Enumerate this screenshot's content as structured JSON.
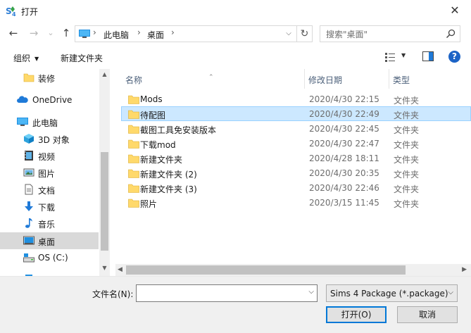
{
  "window": {
    "title": "打开",
    "close_glyph": "✕"
  },
  "nav": {
    "back_glyph": "←",
    "forward_glyph": "→",
    "recent_glyph": "⌄",
    "up_glyph": "↑",
    "breadcrumbs": [
      "此电脑",
      "桌面"
    ],
    "refresh_glyph": "↻",
    "search_placeholder": "搜索\"桌面\""
  },
  "toolbar": {
    "organize_label": "组织",
    "new_folder_label": "新建文件夹"
  },
  "sidebar": {
    "items": [
      {
        "label": "装修",
        "icon": "folder-icon"
      },
      {
        "label": "OneDrive",
        "icon": "cloud-icon"
      },
      {
        "label": "此电脑",
        "icon": "computer-icon"
      },
      {
        "label": "3D 对象",
        "icon": "3d-objects-icon"
      },
      {
        "label": "视频",
        "icon": "video-icon"
      },
      {
        "label": "图片",
        "icon": "pictures-icon"
      },
      {
        "label": "文档",
        "icon": "documents-icon"
      },
      {
        "label": "下载",
        "icon": "download-icon"
      },
      {
        "label": "音乐",
        "icon": "music-icon"
      },
      {
        "label": "桌面",
        "icon": "desktop-icon",
        "selected": true
      },
      {
        "label": "OS (C:)",
        "icon": "drive-icon"
      }
    ]
  },
  "files": {
    "columns": {
      "name": "名称",
      "date": "修改日期",
      "type": "类型"
    },
    "rows": [
      {
        "name": "Mods",
        "date": "2020/4/30 22:15",
        "type": "文件夹"
      },
      {
        "name": "待配图",
        "date": "2020/4/30 22:49",
        "type": "文件夹",
        "selected": true
      },
      {
        "name": "截图工具免安装版本",
        "date": "2020/4/30 22:45",
        "type": "文件夹"
      },
      {
        "name": "下载mod",
        "date": "2020/4/30 22:47",
        "type": "文件夹"
      },
      {
        "name": "新建文件夹",
        "date": "2020/4/28 18:11",
        "type": "文件夹"
      },
      {
        "name": "新建文件夹 (2)",
        "date": "2020/4/30 20:35",
        "type": "文件夹"
      },
      {
        "name": "新建文件夹 (3)",
        "date": "2020/4/30 22:46",
        "type": "文件夹"
      },
      {
        "name": "照片",
        "date": "2020/3/15 11:45",
        "type": "文件夹"
      }
    ]
  },
  "bottom": {
    "filename_label": "文件名(N):",
    "filename_value": "",
    "filter_value": "Sims 4 Package (*.package)",
    "open_label": "打开(O)",
    "cancel_label": "取消"
  },
  "colors": {
    "accent": "#0078d7",
    "selection": "#cce8ff",
    "folder": "#ffd96b"
  }
}
